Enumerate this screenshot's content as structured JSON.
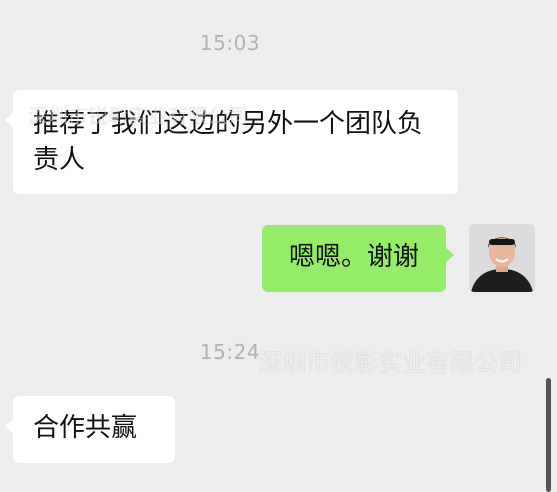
{
  "chat": {
    "timestamps": [
      "15:03",
      "15:24"
    ],
    "messages": [
      {
        "direction": "incoming",
        "text": "推荐了我们这边的另外一个团队负责人"
      },
      {
        "direction": "outgoing",
        "text": "嗯嗯。谢谢"
      },
      {
        "direction": "incoming",
        "text": "合作共赢"
      }
    ]
  },
  "watermark": {
    "text": "深圳市锐彰实业有限公司"
  },
  "colors": {
    "background": "#ededed",
    "incoming_bubble": "#ffffff",
    "outgoing_bubble": "#95ec69",
    "timestamp": "#b3b3b3",
    "text": "#111111"
  }
}
